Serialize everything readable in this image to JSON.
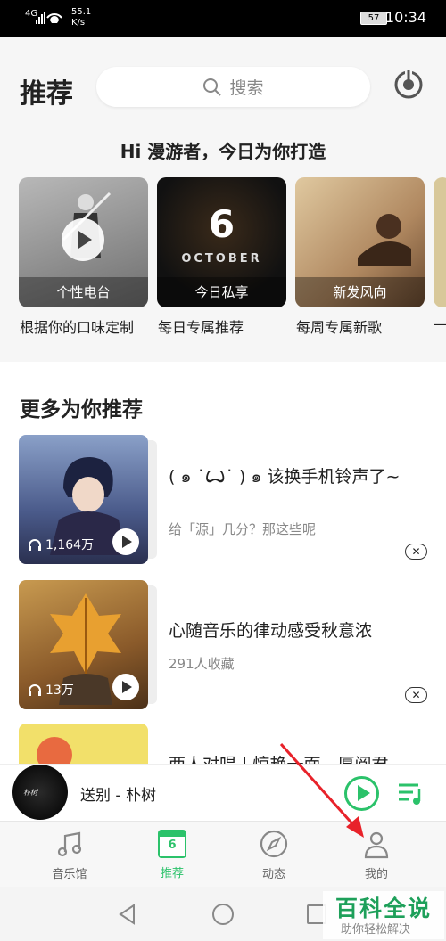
{
  "status_bar": {
    "network": "4G",
    "speed_value": "55.1",
    "speed_unit": "K/s",
    "battery": "57",
    "time": "10:34"
  },
  "header": {
    "title": "推荐",
    "search_placeholder": "搜索",
    "radar_icon": "radar-icon"
  },
  "greeting": "Hi 漫游者，今日为你打造",
  "daily_cards": [
    {
      "label": "个性电台",
      "caption": "根据你的口味定制",
      "color": "#8c8c8c"
    },
    {
      "label": "今日私享",
      "caption": "每日专属推荐",
      "number": "6",
      "subtitle": "OCTOBER",
      "color": "#2a2a2a"
    },
    {
      "label": "新发风向",
      "caption": "每周专属新歌",
      "color": "#c9a779"
    }
  ],
  "more_section": {
    "title": "更多为你推荐",
    "items": [
      {
        "title": "( ๑ ˙Ꙍ˙ ) ๑ 该换手机铃声了~",
        "subtitle": "给「源」几分？那这些呢",
        "count": "1,164万"
      },
      {
        "title": "心随音乐的律动感受秋意浓",
        "subtitle": "291人收藏",
        "count": "13万"
      },
      {
        "title": "两人对唱 | 惊艳一面，厚阅君"
      }
    ]
  },
  "player": {
    "song": "送别 - 朴树",
    "cover_text": "朴树"
  },
  "tabs": [
    {
      "label": "音乐馆",
      "icon": "music-note-icon"
    },
    {
      "label": "推荐",
      "icon": "calendar-icon",
      "day": "6",
      "active": true
    },
    {
      "label": "动态",
      "icon": "compass-icon"
    },
    {
      "label": "我的",
      "icon": "person-icon"
    }
  ],
  "watermark": {
    "title": "百科全说",
    "subtitle": "助你轻松解决"
  },
  "colors": {
    "accent": "#2bc26a",
    "arrow": "#e8222a"
  }
}
